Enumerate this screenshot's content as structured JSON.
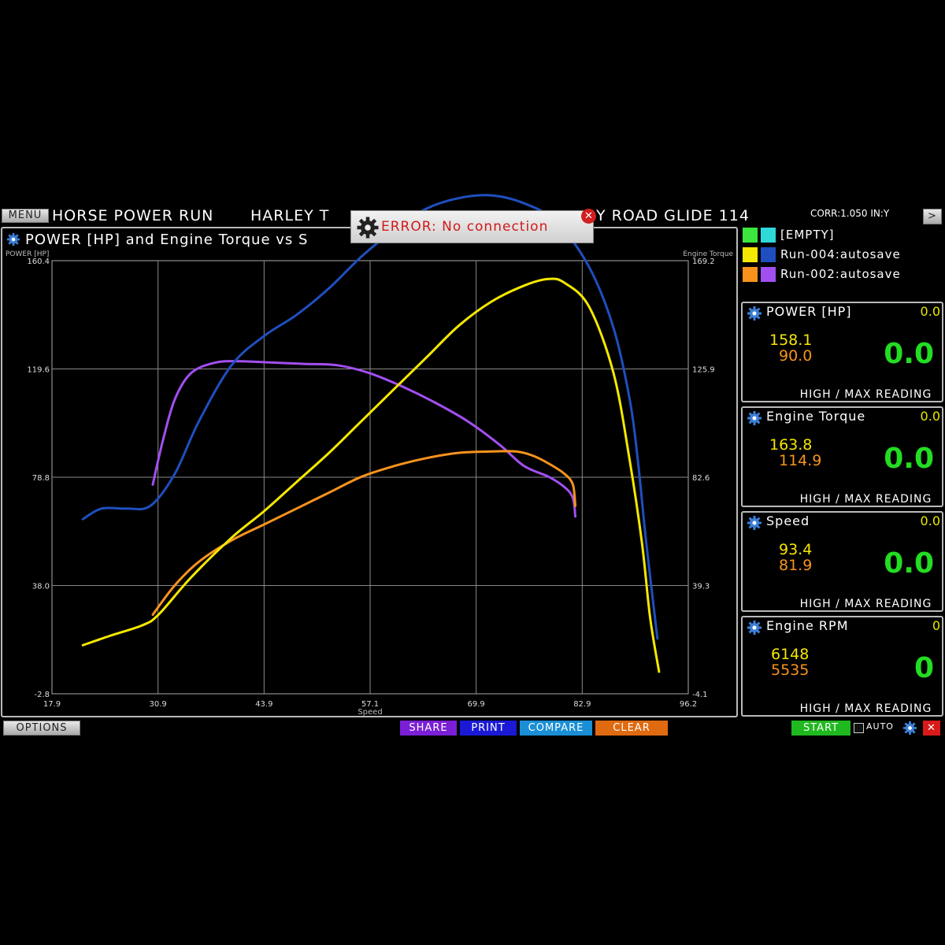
{
  "header": {
    "menu_label": "MENU",
    "run_title": "HORSE POWER RUN",
    "vehicle_title": "HARLEY TOURING ROAD GLIDE 114",
    "vehicle_left": "HARLEY T",
    "vehicle_right": "Y ROAD GLIDE  114",
    "correction": "CORR:1.050 IN:Y",
    "next_label": ">"
  },
  "error_dialog": {
    "message": "ERROR: No connection"
  },
  "chart_panel": {
    "title": "POWER [HP] and Engine Torque vs S",
    "left_axis_label": "POWER [HP]",
    "right_axis_label": "Engine Torque",
    "x_axis_label": "Speed"
  },
  "chart_data": {
    "type": "line",
    "title": "POWER [HP] and Engine Torque vs Speed",
    "xlabel": "Speed",
    "ylabel": "POWER [HP]",
    "y2label": "Engine Torque",
    "x_ticks": [
      "17.9",
      "30.9",
      "43.9",
      "57.1",
      "69.9",
      "82.9",
      "96.2"
    ],
    "y_ticks": [
      "-2.8",
      "38.0",
      "78.8",
      "119.6",
      "160.4"
    ],
    "y2_ticks": [
      "-4.1",
      "39.3",
      "82.6",
      "125.9",
      "169.2"
    ],
    "xlim": [
      17.9,
      96.2
    ],
    "ylim": [
      -2.8,
      160.4
    ],
    "y2lim": [
      -4.1,
      169.2
    ],
    "grid": true,
    "series": [
      {
        "name": "Run-004:autosave",
        "metric": "Engine Torque",
        "color": "#1f4fbf",
        "x": [
          21.7,
          24,
          27,
          30,
          33,
          36,
          40,
          44,
          48,
          52,
          56,
          60,
          64,
          68,
          72,
          76,
          80,
          84,
          87,
          89,
          90,
          91,
          92.4
        ],
        "y": [
          63,
          67,
          67,
          68,
          80,
          100,
          121,
          132,
          140,
          150,
          162,
          172,
          180,
          184,
          185,
          182,
          175,
          158,
          135,
          108,
          85,
          55,
          18
        ]
      },
      {
        "name": "Run-004:autosave",
        "metric": "POWER [HP]",
        "color": "#f5e800",
        "x": [
          21.7,
          25,
          29,
          31,
          35,
          40,
          44,
          48,
          52,
          56,
          60,
          64,
          68,
          72,
          76,
          79,
          81,
          84,
          87,
          89,
          90.5,
          91.5,
          92.6
        ],
        "y": [
          15.5,
          19,
          23,
          27,
          41,
          56,
          66,
          77,
          88,
          100,
          112,
          124,
          136,
          145,
          151,
          153.5,
          152,
          143,
          118,
          85,
          54,
          26,
          5.5
        ]
      },
      {
        "name": "Run-002:autosave",
        "metric": "Engine Torque",
        "color": "#a24ff0",
        "x": [
          30.3,
          31.5,
          33,
          35,
          38,
          41,
          45,
          49,
          53,
          57,
          61,
          65,
          69,
          73,
          76,
          79,
          81,
          82,
          82.3
        ],
        "y": [
          76,
          92,
          108,
          118,
          122,
          122.5,
          122,
          121.5,
          121,
          118,
          113,
          107,
          100,
          91,
          83,
          79,
          75,
          71,
          64
        ]
      },
      {
        "name": "Run-002:autosave",
        "metric": "POWER [HP]",
        "color": "#f7931d",
        "x": [
          30.3,
          33,
          36,
          40,
          44,
          48,
          52,
          56,
          60,
          64,
          68,
          72,
          75,
          77,
          79,
          81,
          82,
          82.3
        ],
        "y": [
          27,
          38,
          47,
          55,
          61,
          67,
          73,
          79,
          83,
          86,
          88,
          88.5,
          88.5,
          87,
          84,
          80,
          76,
          68
        ]
      }
    ]
  },
  "legend": [
    {
      "label": "[EMPTY]",
      "color_a": "#3de63d",
      "color_b": "#2fd9d9"
    },
    {
      "label": "Run-004:autosave",
      "color_a": "#f5e800",
      "color_b": "#1f4fbf"
    },
    {
      "label": "Run-002:autosave",
      "color_a": "#f7931d",
      "color_b": "#a24ff0"
    }
  ],
  "gauges": [
    {
      "title": "POWER [HP]",
      "current": "0.0",
      "high": "158.1",
      "max": "90.0",
      "big": "0.0",
      "footer": "HIGH / MAX READING"
    },
    {
      "title": "Engine Torque",
      "current": "0.0",
      "high": "163.8",
      "max": "114.9",
      "big": "0.0",
      "footer": "HIGH / MAX READING"
    },
    {
      "title": "Speed",
      "current": "0.0",
      "high": "93.4",
      "max": "81.9",
      "big": "0.0",
      "footer": "HIGH / MAX READING"
    },
    {
      "title": "Engine RPM",
      "current": "0",
      "high": "6148",
      "max": "5535",
      "big": "0",
      "footer": "HIGH / MAX READING"
    }
  ],
  "footer": {
    "options_label": "OPTIONS",
    "share_label": "SHARE",
    "print_label": "PRINT",
    "compare_label": "COMPARE",
    "clear_label": "CLEAR",
    "start_label": "START",
    "auto_label": "AUTO",
    "close_label": "✕"
  },
  "colors": {
    "share": "#7a1fd6",
    "print": "#1a1ad6",
    "compare": "#1a8fd6",
    "clear": "#e06a10",
    "start": "#1fb81f",
    "close": "#d81a1a",
    "gauge_green": "#22dd22"
  }
}
